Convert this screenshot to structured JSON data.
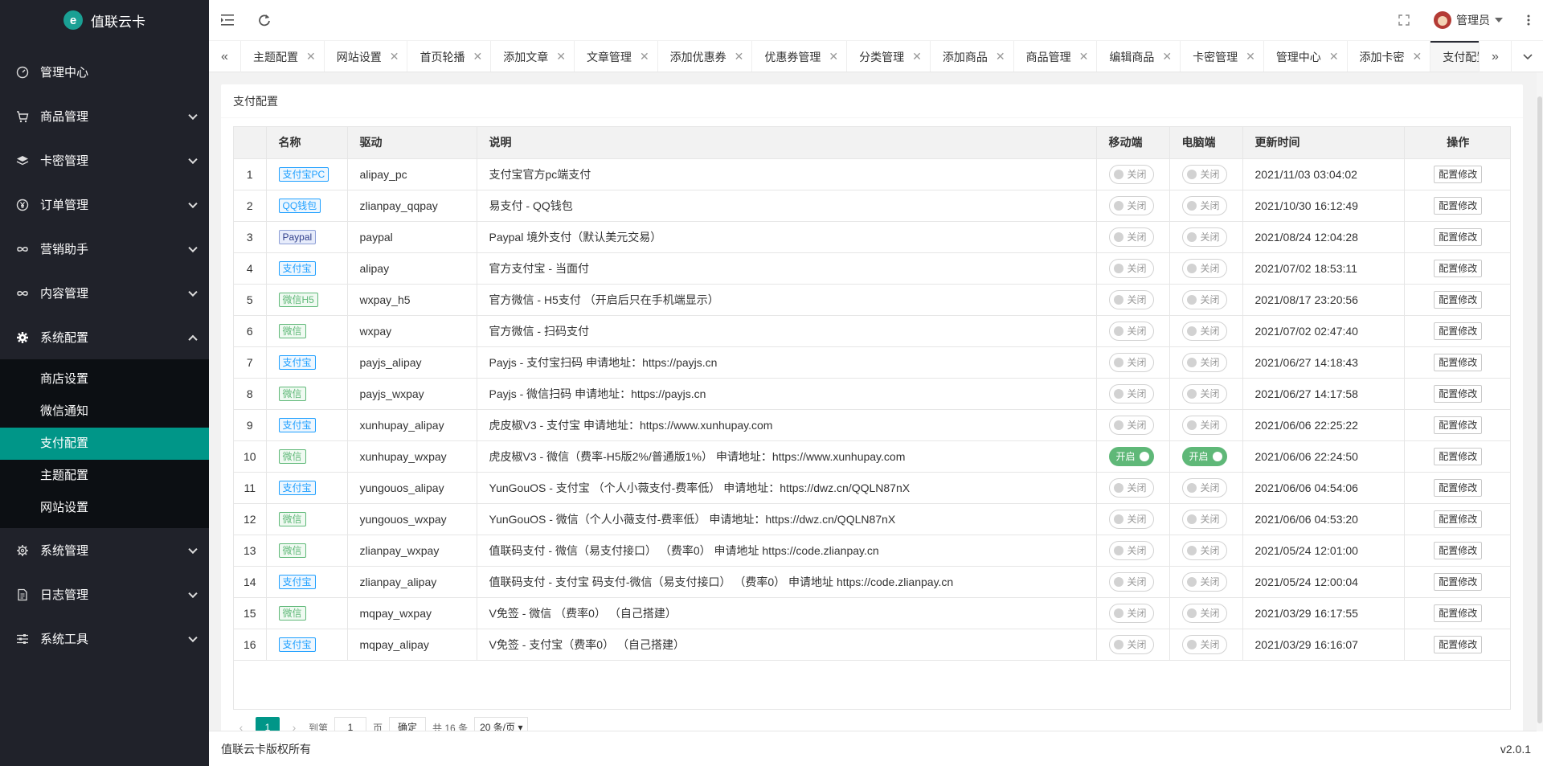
{
  "app": {
    "title": "值联云卡",
    "logo_letter": "e"
  },
  "sidebar": {
    "menu": [
      {
        "label": "管理中心",
        "icon": "gauge-icon",
        "has_children": false
      },
      {
        "label": "商品管理",
        "icon": "cart-icon",
        "has_children": true
      },
      {
        "label": "卡密管理",
        "icon": "layers-icon",
        "has_children": true
      },
      {
        "label": "订单管理",
        "icon": "yen-icon",
        "has_children": true
      },
      {
        "label": "营销助手",
        "icon": "infinity-icon",
        "has_children": true
      },
      {
        "label": "内容管理",
        "icon": "infinity-icon",
        "has_children": true
      },
      {
        "label": "系统配置",
        "icon": "gear-icon",
        "has_children": true,
        "open": true,
        "children": [
          "商店设置",
          "微信通知",
          "支付配置",
          "主题配置",
          "网站设置"
        ],
        "active_child": "支付配置"
      },
      {
        "label": "系统管理",
        "icon": "gear-outline-icon",
        "has_children": true
      },
      {
        "label": "日志管理",
        "icon": "document-icon",
        "has_children": true
      },
      {
        "label": "系统工具",
        "icon": "sliders-icon",
        "has_children": true
      }
    ]
  },
  "header": {
    "user_label": "管理员"
  },
  "tabs": {
    "items": [
      "主题配置",
      "网站设置",
      "首页轮播",
      "添加文章",
      "文章管理",
      "添加优惠券",
      "优惠券管理",
      "分类管理",
      "添加商品",
      "商品管理",
      "编辑商品",
      "卡密管理",
      "管理中心",
      "添加卡密",
      "支付配置"
    ],
    "active": "支付配置"
  },
  "card": {
    "title": "支付配置"
  },
  "table": {
    "headers": {
      "name": "名称",
      "driver": "驱动",
      "desc": "说明",
      "mobile": "移动端",
      "pc": "电脑端",
      "updated": "更新时间",
      "ops": "操作"
    },
    "switch_off_label": "关闭",
    "switch_on_label": "开启",
    "op_label": "配置修改",
    "rows": [
      {
        "no": "1",
        "name": "支付宝PC",
        "badge": "b-ali",
        "driver": "alipay_pc",
        "desc": "支付宝官方pc端支付",
        "mobile": false,
        "pc": false,
        "updated": "2021/11/03 03:04:02"
      },
      {
        "no": "2",
        "name": "QQ钱包",
        "badge": "b-qq",
        "driver": "zlianpay_qqpay",
        "desc": "易支付 - QQ钱包",
        "mobile": false,
        "pc": false,
        "updated": "2021/10/30 16:12:49"
      },
      {
        "no": "3",
        "name": "Paypal",
        "badge": "b-pp",
        "driver": "paypal",
        "desc": "Paypal 境外支付（默认美元交易）",
        "mobile": false,
        "pc": false,
        "updated": "2021/08/24 12:04:28"
      },
      {
        "no": "4",
        "name": "支付宝",
        "badge": "b-ali",
        "driver": "alipay",
        "desc": "官方支付宝 - 当面付",
        "mobile": false,
        "pc": false,
        "updated": "2021/07/02 18:53:11"
      },
      {
        "no": "5",
        "name": "微信H5",
        "badge": "b-wx",
        "driver": "wxpay_h5",
        "desc": "官方微信 - H5支付 （开启后只在手机端显示）",
        "mobile": false,
        "pc": false,
        "updated": "2021/08/17 23:20:56"
      },
      {
        "no": "6",
        "name": "微信",
        "badge": "b-wx",
        "driver": "wxpay",
        "desc": "官方微信 - 扫码支付",
        "mobile": false,
        "pc": false,
        "updated": "2021/07/02 02:47:40"
      },
      {
        "no": "7",
        "name": "支付宝",
        "badge": "b-ali",
        "driver": "payjs_alipay",
        "desc": "Payjs - 支付宝扫码 申请地址：https://payjs.cn",
        "mobile": false,
        "pc": false,
        "updated": "2021/06/27 14:18:43"
      },
      {
        "no": "8",
        "name": "微信",
        "badge": "b-wx",
        "driver": "payjs_wxpay",
        "desc": "Payjs - 微信扫码 申请地址：https://payjs.cn",
        "mobile": false,
        "pc": false,
        "updated": "2021/06/27 14:17:58"
      },
      {
        "no": "9",
        "name": "支付宝",
        "badge": "b-ali",
        "driver": "xunhupay_alipay",
        "desc": "虎皮椒V3 - 支付宝 申请地址：https://www.xunhupay.com",
        "mobile": false,
        "pc": false,
        "updated": "2021/06/06 22:25:22"
      },
      {
        "no": "10",
        "name": "微信",
        "badge": "b-wx",
        "driver": "xunhupay_wxpay",
        "desc": "虎皮椒V3 - 微信（费率-H5版2%/普通版1%） 申请地址：https://www.xunhupay.com",
        "mobile": true,
        "pc": true,
        "updated": "2021/06/06 22:24:50"
      },
      {
        "no": "11",
        "name": "支付宝",
        "badge": "b-ali",
        "driver": "yungouos_alipay",
        "desc": "YunGouOS - 支付宝 （个人小薇支付-费率低） 申请地址：https://dwz.cn/QQLN87nX",
        "mobile": false,
        "pc": false,
        "updated": "2021/06/06 04:54:06"
      },
      {
        "no": "12",
        "name": "微信",
        "badge": "b-wx",
        "driver": "yungouos_wxpay",
        "desc": "YunGouOS - 微信（个人小薇支付-费率低） 申请地址：https://dwz.cn/QQLN87nX",
        "mobile": false,
        "pc": false,
        "updated": "2021/06/06 04:53:20"
      },
      {
        "no": "13",
        "name": "微信",
        "badge": "b-wx",
        "driver": "zlianpay_wxpay",
        "desc": "值联码支付 - 微信（易支付接口） （费率0） 申请地址 https://code.zlianpay.cn",
        "mobile": false,
        "pc": false,
        "updated": "2021/05/24 12:01:00"
      },
      {
        "no": "14",
        "name": "支付宝",
        "badge": "b-ali",
        "driver": "zlianpay_alipay",
        "desc": "值联码支付 - 支付宝 码支付-微信（易支付接口） （费率0） 申请地址 https://code.zlianpay.cn",
        "mobile": false,
        "pc": false,
        "updated": "2021/05/24 12:00:04"
      },
      {
        "no": "15",
        "name": "微信",
        "badge": "b-wx",
        "driver": "mqpay_wxpay",
        "desc": "V免签 - 微信 （费率0） （自己搭建）",
        "mobile": false,
        "pc": false,
        "updated": "2021/03/29 16:17:55"
      },
      {
        "no": "16",
        "name": "支付宝",
        "badge": "b-ali",
        "driver": "mqpay_alipay",
        "desc": "V免签 - 支付宝（费率0） （自己搭建）",
        "mobile": false,
        "pc": false,
        "updated": "2021/03/29 16:16:07"
      }
    ]
  },
  "pager": {
    "current": "1",
    "goto_label": "到第",
    "page_input": "1",
    "page_unit": "页",
    "confirm_label": "确定",
    "total": "共 16 条",
    "per_page": "20 条/页"
  },
  "footer": {
    "copyright": "值联云卡版权所有",
    "version": "v2.0.1"
  }
}
